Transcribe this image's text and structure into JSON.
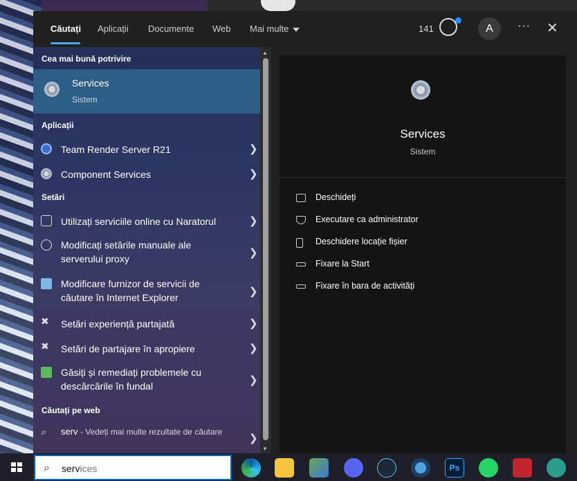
{
  "tabs": [
    {
      "label": "Căutați",
      "active": true
    },
    {
      "label": "Aplicații"
    },
    {
      "label": "Documente"
    },
    {
      "label": "Web"
    },
    {
      "label": "Mai multe"
    }
  ],
  "header": {
    "points": "141",
    "avatar": "A",
    "more": "···",
    "close": "✕"
  },
  "best_match": {
    "section": "Cea mai bună potrivire",
    "title": "Services",
    "subtitle": "Sistem",
    "icon": "gear-icon"
  },
  "apps": {
    "section": "Aplicații",
    "items": [
      {
        "label": "Team Render Server R21",
        "icon": "cinema4d-icon"
      },
      {
        "label": "Component Services",
        "icon": "component-services-icon"
      }
    ]
  },
  "settings": {
    "section": "Setări",
    "items": [
      {
        "label": "Utilizați serviciile online cu Naratorul",
        "icon": "narrator-icon"
      },
      {
        "label": "Modificați setările manuale ale serverului proxy",
        "icon": "globe-icon"
      },
      {
        "label": "Modificare furnizor de servicii de căutare în Internet Explorer",
        "icon": "ie-icon"
      },
      {
        "label": "Setări experiență partajată",
        "icon": "share-icon"
      },
      {
        "label": "Setări de partajare în apropiere",
        "icon": "nearby-share-icon"
      },
      {
        "label": "Găsiți și remediați problemele cu descărcările în fundal",
        "icon": "troubleshoot-icon"
      }
    ]
  },
  "web": {
    "section": "Căutați pe web",
    "query": "serv",
    "suffix": " - Vedeți mai multe rezultate de căutare"
  },
  "preview": {
    "title": "Services",
    "subtitle": "Sistem",
    "actions": [
      {
        "label": "Deschideți",
        "icon": "open-icon"
      },
      {
        "label": "Executare ca administrator",
        "icon": "shield-icon"
      },
      {
        "label": "Deschidere locație fișier",
        "icon": "folder-icon"
      },
      {
        "label": "Fixare la Start",
        "icon": "pin-icon"
      },
      {
        "label": "Fixare în bara de activități",
        "icon": "pin-icon"
      }
    ]
  },
  "taskbar": {
    "search_typed": "serv",
    "search_placeholder": "ices",
    "icons": [
      "edge-icon",
      "file-explorer-icon",
      "store-icon",
      "discord-icon",
      "steam-icon",
      "app-icon",
      "photoshop-icon",
      "whatsapp-icon",
      "game-icon",
      "app2-icon"
    ],
    "photoshop_label": "Ps"
  }
}
